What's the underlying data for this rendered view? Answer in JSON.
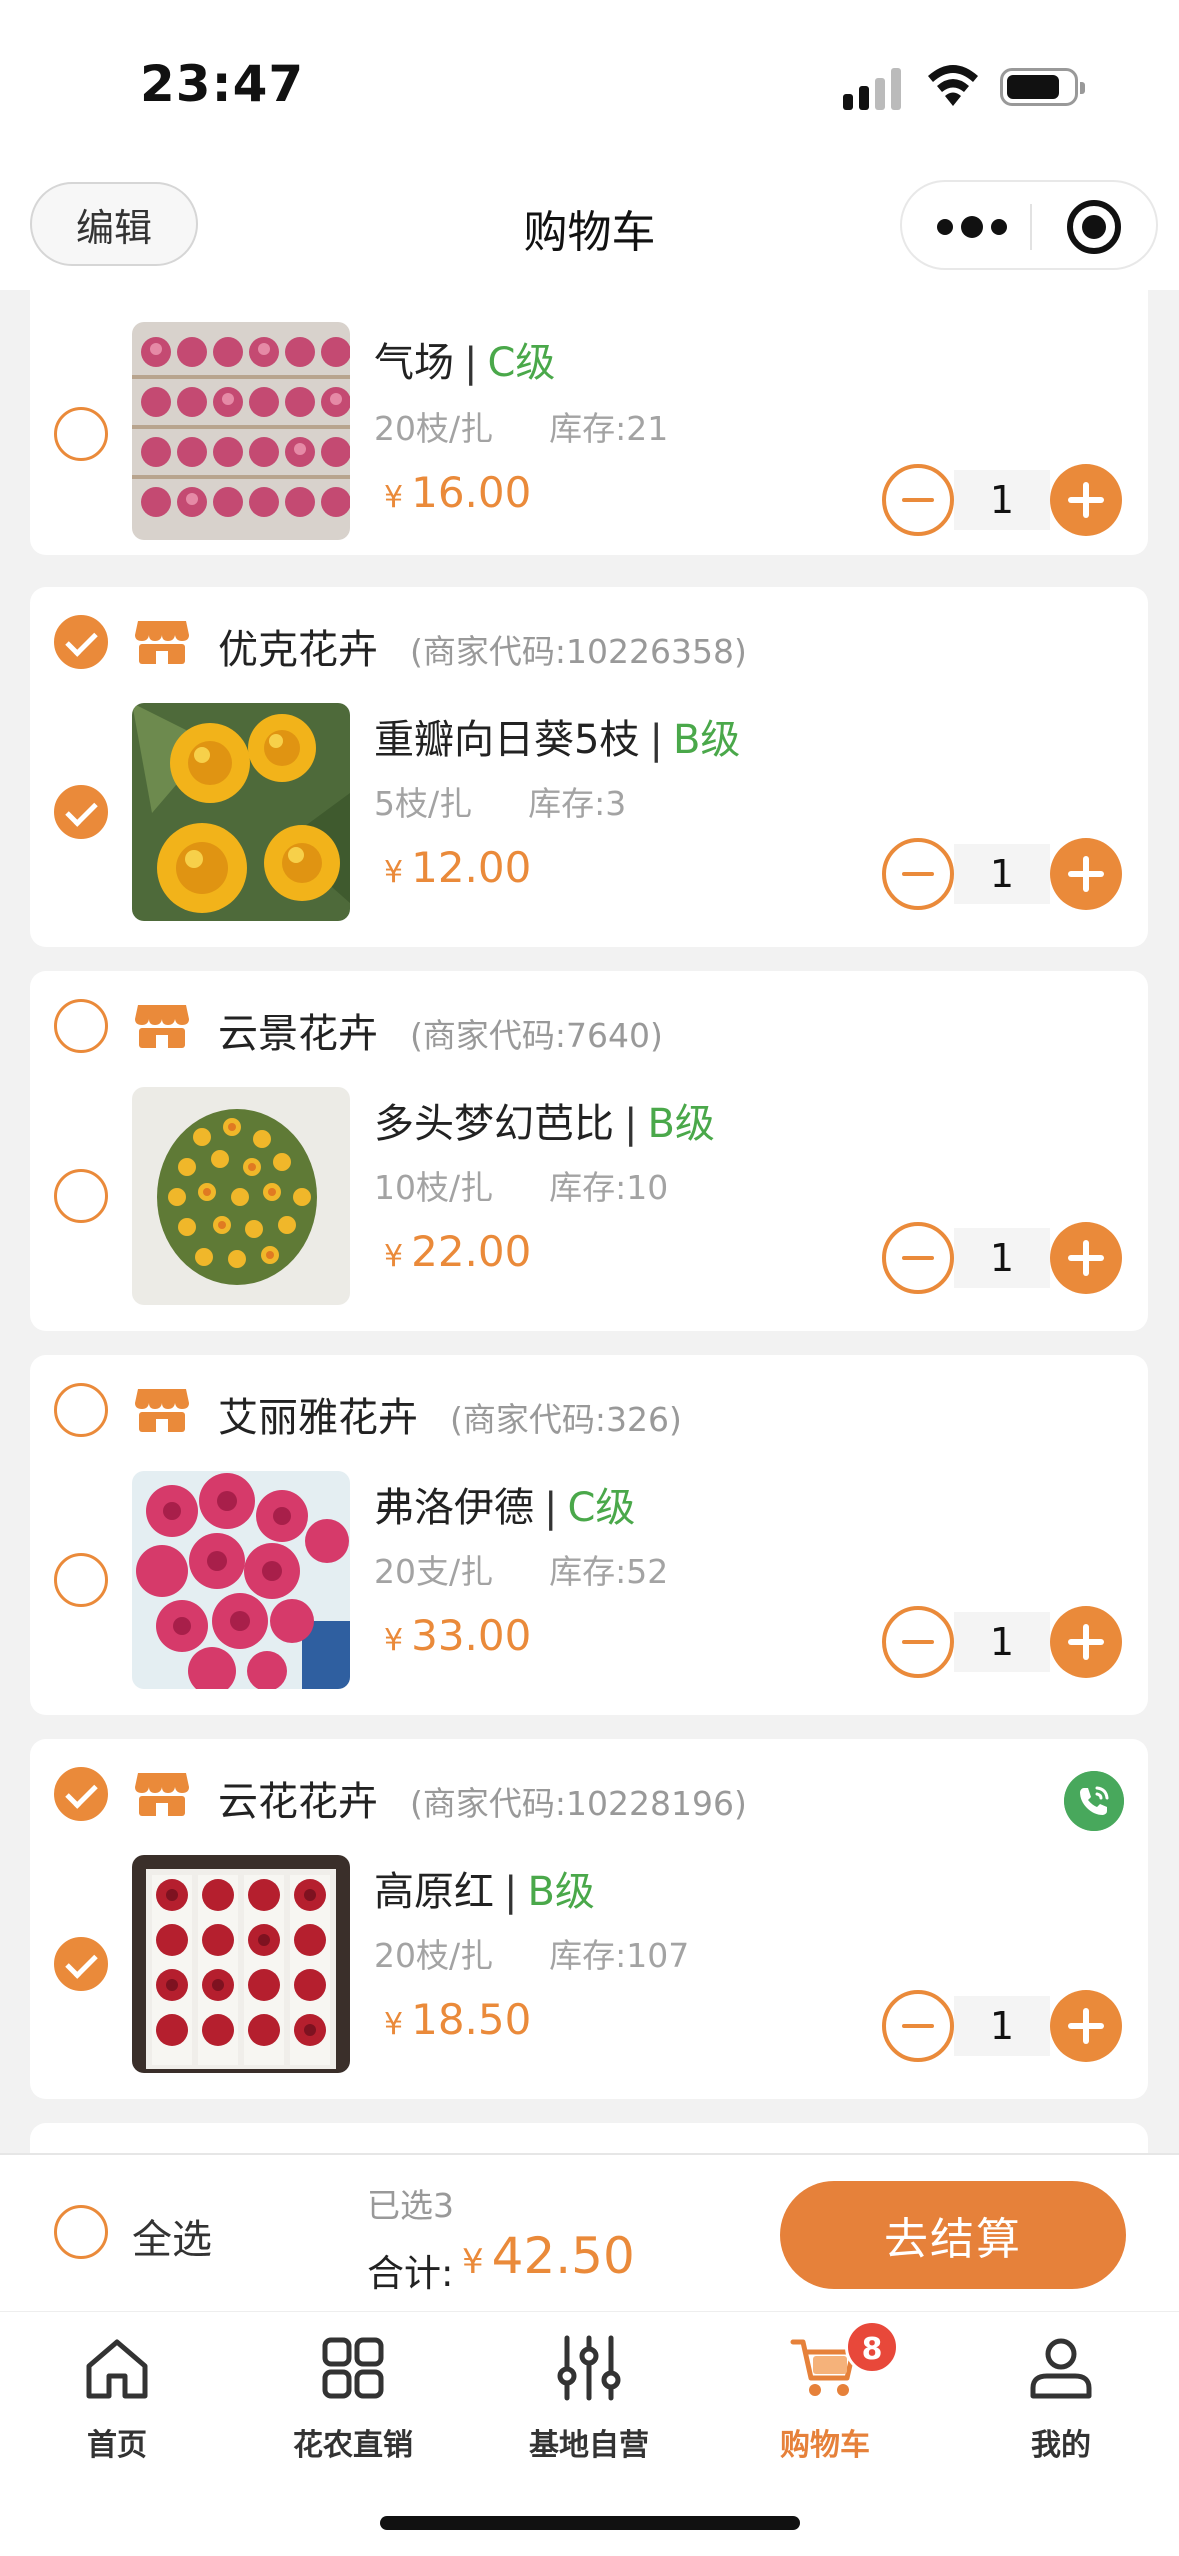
{
  "status_bar": {
    "time": "23:47"
  },
  "nav": {
    "edit_label": "编辑",
    "title": "购物车"
  },
  "cart": {
    "cards": [
      {
        "shop": null,
        "items": [
          {
            "name": "气场",
            "grade": "C级",
            "spec": "20枝/扎",
            "stock": "库存:21",
            "price": "16.00",
            "qty": "1",
            "checked": false
          }
        ]
      },
      {
        "shop": {
          "name": "优克花卉",
          "code": "(商家代码:10226358)",
          "checked": true
        },
        "items": [
          {
            "name": "重瓣向日葵5枝",
            "grade": "B级",
            "spec": "5枝/扎",
            "stock": "库存:3",
            "price": "12.00",
            "qty": "1",
            "checked": true
          }
        ]
      },
      {
        "shop": {
          "name": "云景花卉",
          "code": "(商家代码:7640)",
          "checked": false
        },
        "items": [
          {
            "name": "多头梦幻芭比",
            "grade": "B级",
            "spec": "10枝/扎",
            "stock": "库存:10",
            "price": "22.00",
            "qty": "1",
            "checked": false
          }
        ]
      },
      {
        "shop": {
          "name": "艾丽雅花卉",
          "code": "(商家代码:326)",
          "checked": false
        },
        "items": [
          {
            "name": "弗洛伊德",
            "grade": "C级",
            "spec": "20支/扎",
            "stock": "库存:52",
            "price": "33.00",
            "qty": "1",
            "checked": false
          }
        ]
      },
      {
        "shop": {
          "name": "云花花卉",
          "code": "(商家代码:10228196)",
          "checked": true,
          "has_phone": true
        },
        "items": [
          {
            "name": "高原红",
            "grade": "B级",
            "spec": "20枝/扎",
            "stock": "库存:107",
            "price": "18.50",
            "qty": "1",
            "checked": true
          }
        ]
      }
    ],
    "currency": "¥",
    "separator": "|"
  },
  "checkout": {
    "select_all_label": "全选",
    "selected_count": "已选3",
    "total_label": "合计:",
    "currency": "¥",
    "total": "42.50",
    "checkout_label": "去结算"
  },
  "tabbar": {
    "tabs": [
      {
        "label": "首页",
        "icon": "home-icon"
      },
      {
        "label": "花农直销",
        "icon": "grid-icon"
      },
      {
        "label": "基地自营",
        "icon": "sliders-icon"
      },
      {
        "label": "购物车",
        "icon": "cart-icon",
        "active": true,
        "badge": "8"
      },
      {
        "label": "我的",
        "icon": "user-icon"
      }
    ]
  },
  "colors": {
    "accent": "#ea8a3a",
    "grade": "#4aa84a",
    "badge": "#e8483a",
    "phone": "#48a85c"
  }
}
